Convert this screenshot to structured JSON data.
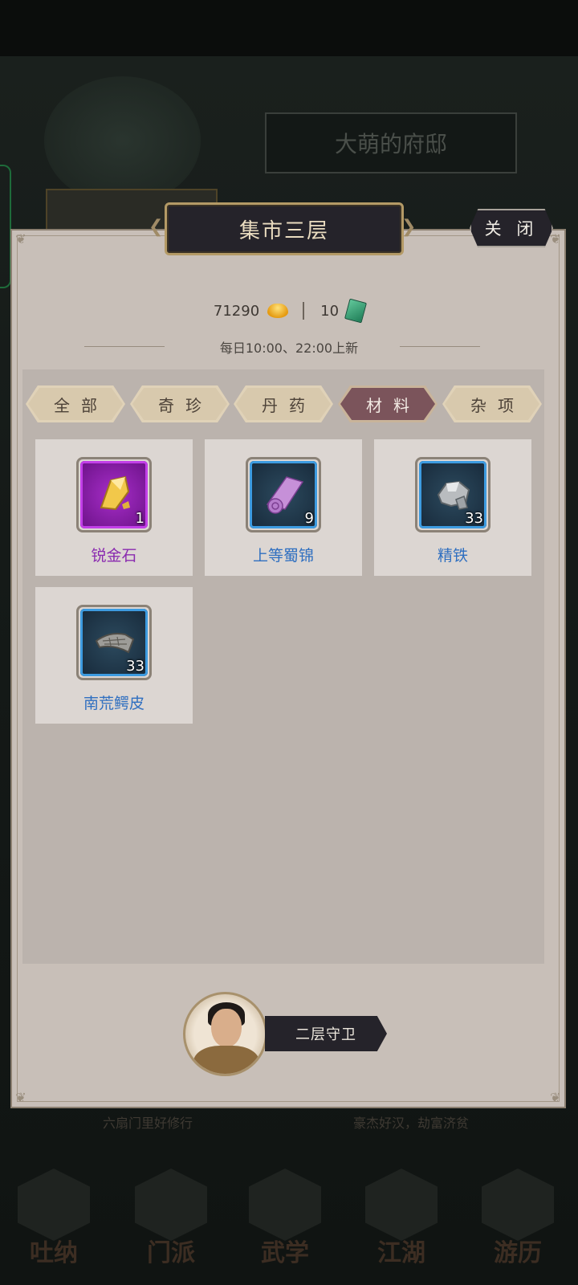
{
  "background": {
    "title": "大萌的府邸",
    "footer_left": "六扇门里好修行",
    "footer_right": "豪杰好汉，劫富济贫",
    "nav": [
      "吐纳",
      "门派",
      "武学",
      "江湖",
      "游历"
    ]
  },
  "panel": {
    "title": "集市三层",
    "close_label": "关 闭",
    "currency": {
      "gold": "71290",
      "jade": "10"
    },
    "refresh_text": "每日10:00、22:00上新"
  },
  "tabs": [
    {
      "label": "全部",
      "active": false
    },
    {
      "label": "奇珍",
      "active": false
    },
    {
      "label": "丹药",
      "active": false
    },
    {
      "label": "材料",
      "active": true
    },
    {
      "label": "杂项",
      "active": false
    }
  ],
  "items": [
    {
      "name": "锐金石",
      "qty": "1",
      "rarity": "purple",
      "icon": "gold-stone-icon"
    },
    {
      "name": "上等蜀锦",
      "qty": "9",
      "rarity": "blue",
      "icon": "silk-roll-icon"
    },
    {
      "name": "精铁",
      "qty": "33",
      "rarity": "blue",
      "icon": "iron-ore-icon"
    },
    {
      "name": "南荒鳄皮",
      "qty": "33",
      "rarity": "blue",
      "icon": "croc-hide-icon"
    }
  ],
  "guard": {
    "label": "二层守卫"
  },
  "colors": {
    "active_tab": "#7b545b",
    "purple_rarity": "#8a2bb0",
    "blue_rarity": "#2f6fc0"
  }
}
